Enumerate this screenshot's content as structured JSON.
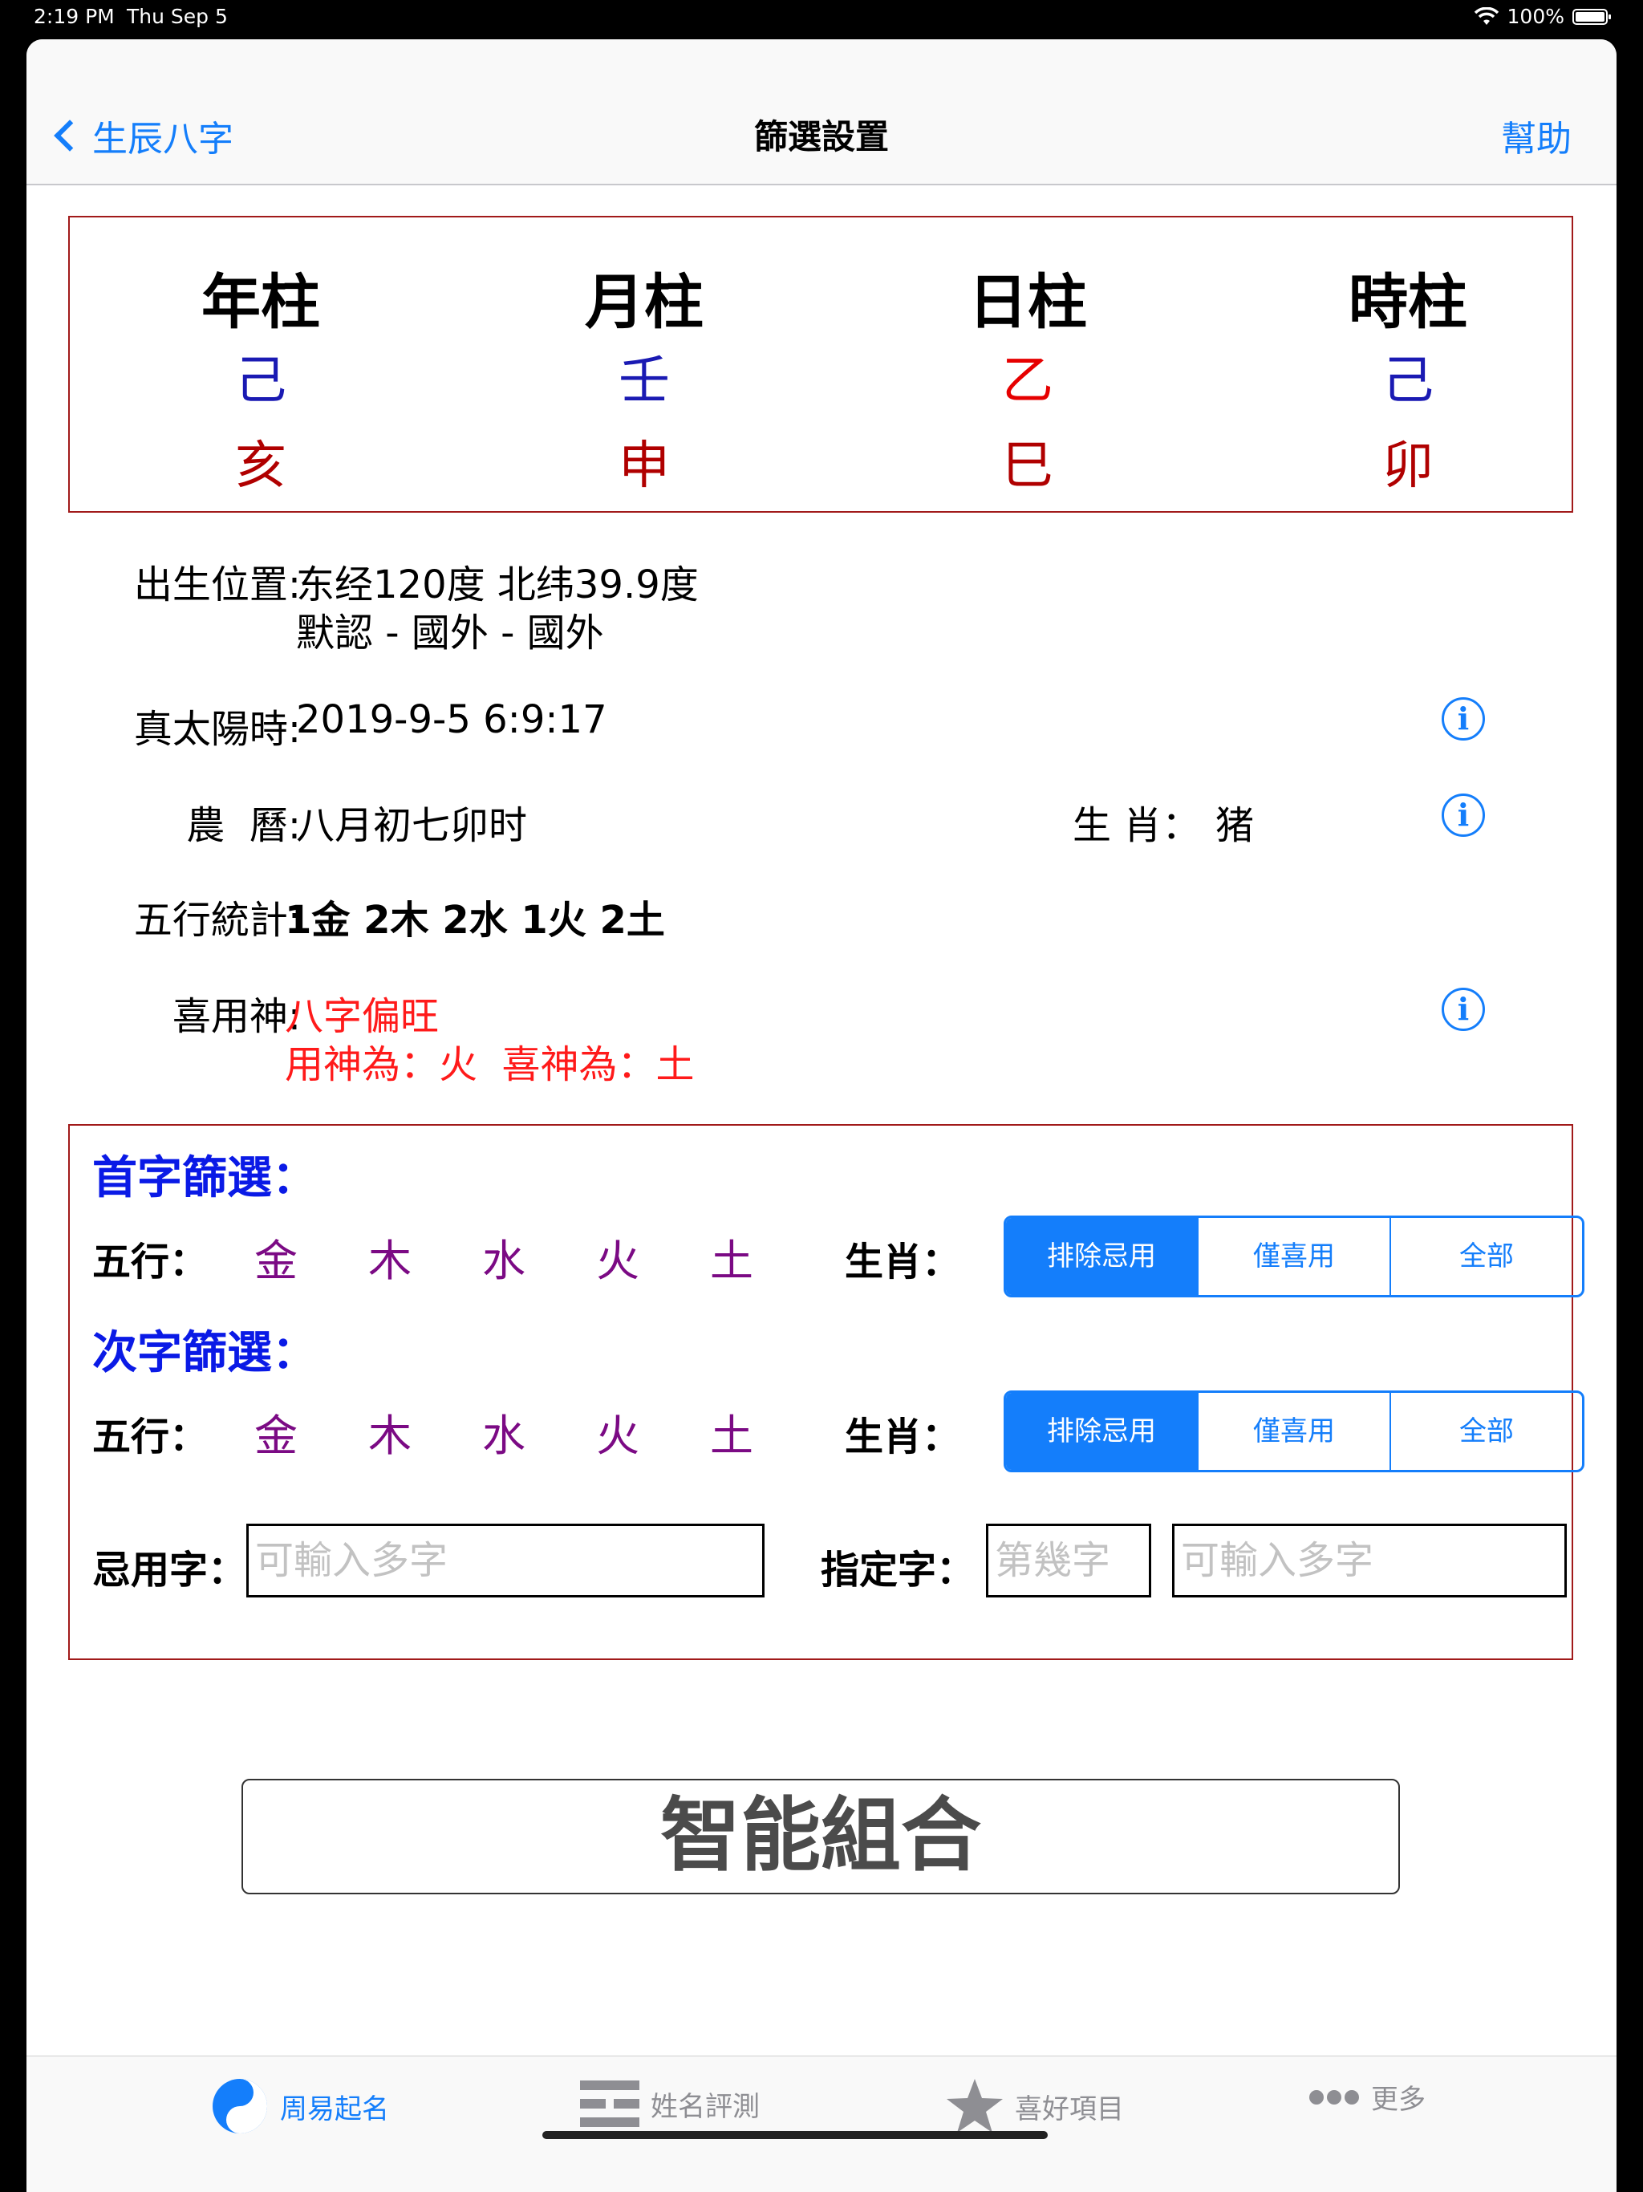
{
  "status": {
    "time": "2:19 PM",
    "date": "Thu Sep 5",
    "battery": "100%"
  },
  "nav": {
    "back_label": "生辰八字",
    "title": "篩選設置",
    "help_label": "幫助"
  },
  "pillars": [
    {
      "head": "年柱",
      "stem": "己",
      "stem_color": "#1a1ab3",
      "branch": "亥",
      "branch_color": "#b00000"
    },
    {
      "head": "月柱",
      "stem": "壬",
      "stem_color": "#1a1ab3",
      "branch": "申",
      "branch_color": "#b00000"
    },
    {
      "head": "日柱",
      "stem": "乙",
      "stem_color": "#e60000",
      "branch": "巳",
      "branch_color": "#b00000"
    },
    {
      "head": "時柱",
      "stem": "己",
      "stem_color": "#1a1ab3",
      "branch": "卯",
      "branch_color": "#b00000"
    }
  ],
  "info": {
    "location_label": "出生位置:",
    "location_line1": "东经120度 北纬39.9度",
    "location_line2": "默認 - 國外 - 國外",
    "solar_label": "真太陽時:",
    "solar_value": "2019-9-5 6:9:17",
    "lunar_label": "農  曆:",
    "lunar_value": "八月初七卯时",
    "zodiac_label": "生 肖：",
    "zodiac_value": "猪",
    "wuxing_label": "五行統計:",
    "wuxing_value": "1金 2木 2水 1火 2土",
    "xiyong_label": "喜用神:",
    "xiyong_line1": "八字偏旺",
    "xiyong_line2": "用神為：火  喜神為：土",
    "xiyong_color": "#ff1a1a"
  },
  "info_icon_glyph": "i",
  "filters": {
    "first_title": "首字篩選：",
    "second_title": "次字篩選：",
    "wuxing_label": "五行：",
    "elements": [
      "金",
      "木",
      "水",
      "火",
      "土"
    ],
    "element_color": "#7b0a84",
    "zodiac_label": "生肖：",
    "segment_options": [
      "排除忌用",
      "僅喜用",
      "全部"
    ],
    "selected_index": 0,
    "avoid_label": "忌用字：",
    "avoid_placeholder": "可輸入多字",
    "assign_label": "指定字：",
    "position_placeholder": "第幾字",
    "assign_placeholder": "可輸入多字"
  },
  "smart_button": "智能組合",
  "tabs": [
    {
      "label": "周易起名",
      "icon": "yin-yang-icon",
      "active": true
    },
    {
      "label": "姓名評測",
      "icon": "trigram-icon",
      "active": false
    },
    {
      "label": "喜好項目",
      "icon": "star-icon",
      "active": false
    },
    {
      "label": "更多",
      "icon": "more-dots-icon",
      "active": false
    }
  ],
  "colors": {
    "accent": "#147efb",
    "frame": "#a11a1a",
    "title_blue": "#0a1ae6"
  }
}
